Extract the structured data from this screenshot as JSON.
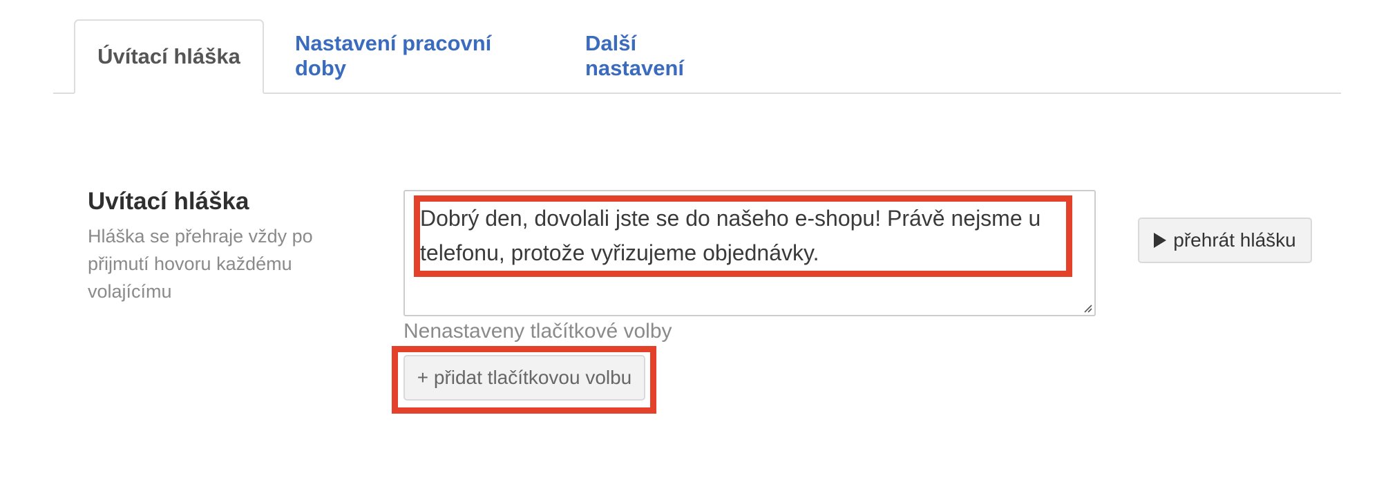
{
  "tabs": [
    {
      "label": "Úvítací hláška",
      "active": true
    },
    {
      "label": "Nastavení pracovní doby",
      "active": false
    },
    {
      "label": "Další nastavení",
      "active": false
    }
  ],
  "greeting": {
    "title": "Uvítací hláška",
    "description": "Hláška se přehraje vždy po přijmutí hovoru každému volajícímu",
    "message": "Dobrý den, dovolali jste se do našeho e-shopu! Právě nejsme u telefonu, protože vyřizujeme objednávky.",
    "play_button_label": "přehrát hlášku",
    "play_icon": "play-icon",
    "no_options_text": "Nenastaveny tlačítkové volby",
    "add_option_label": "+ přidat tlačítkovou volbu"
  },
  "colors": {
    "link": "#3a6bbf",
    "highlight": "#e4412a",
    "muted_text": "#8a8a8a"
  }
}
